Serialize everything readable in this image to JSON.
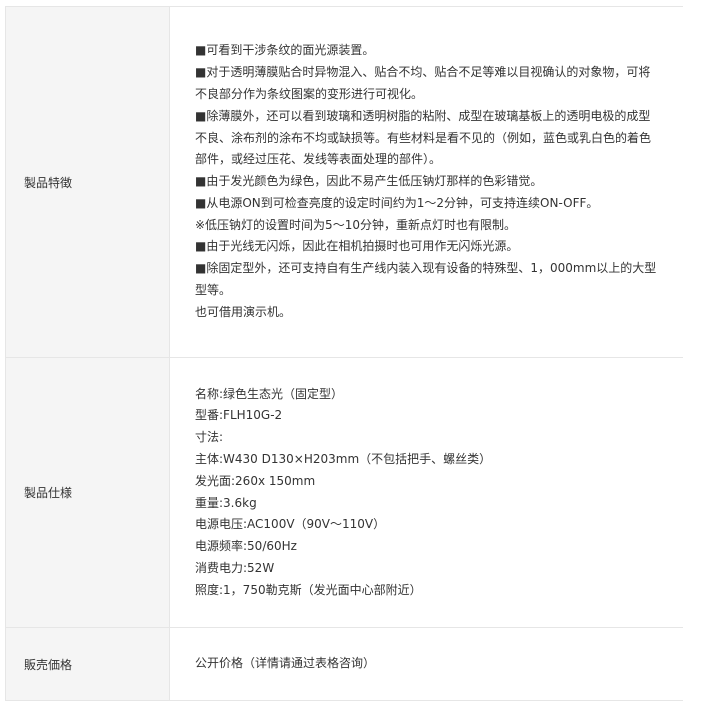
{
  "rows": [
    {
      "heading": "製品特徴",
      "lines": [
        "■可看到干涉条纹的面光源装置。",
        "■对于透明薄膜贴合时异物混入、贴合不均、贴合不足等难以目视确认的对象物，可将",
        "不良部分作为条纹图案的变形进行可视化。",
        "■除薄膜外，还可以看到玻璃和透明树脂的粘附、成型在玻璃基板上的透明电极的成型",
        "不良、涂布剂的涂布不均或缺损等。有些材料是看不见的（例如，蓝色或乳白色的着色",
        "部件，或经过压花、发线等表面处理的部件）。",
        "■由于发光颜色为绿色，因此不易产生低压钠灯那样的色彩错觉。",
        "■从电源ON到可检查亮度的设定时间约为1～2分钟，可支持连续ON-OFF。",
        "※低压钠灯的设置时间为5～10分钟，重新点灯时也有限制。",
        "■由于光线无闪烁，因此在相机拍摄时也可用作无闪烁光源。",
        "■除固定型外，还可支持自有生产线内装入现有设备的特殊型、1，000mm以上的大型",
        "型等。",
        "也可借用演示机。"
      ]
    },
    {
      "heading": "製品仕様",
      "lines": [
        "名称:绿色生态光（固定型）",
        "型番:FLH10G-2",
        "寸法:",
        "主体:W430 D130×H203mm（不包括把手、螺丝类）",
        "发光面:260x 150mm",
        "重量:3.6kg",
        "电源电压:AC100V（90V～110V）",
        "电源频率:50/60Hz",
        "消费电力:52W",
        "照度:1，750勒克斯（发光面中心部附近）"
      ]
    },
    {
      "heading": "販売価格",
      "lines": [
        "公开价格（详情请通过表格咨询）"
      ]
    }
  ]
}
